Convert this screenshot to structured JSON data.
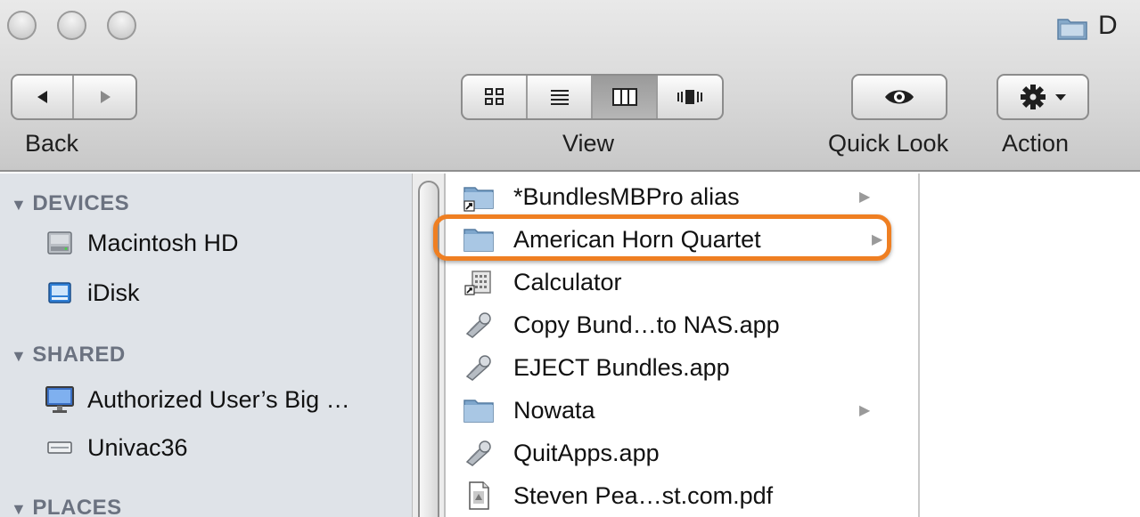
{
  "window": {
    "title": "D"
  },
  "toolbar": {
    "back_label": "Back",
    "view_label": "View",
    "quick_look_label": "Quick Look",
    "action_label": "Action",
    "view_modes": [
      "icon-view-icon",
      "list-view-icon",
      "column-view-icon",
      "cover-flow-icon"
    ],
    "active_view": "column-view-icon"
  },
  "sidebar": {
    "devices": {
      "heading": "DEVICES",
      "items": [
        {
          "label": "Macintosh HD",
          "icon": "hard-drive-icon"
        },
        {
          "label": "iDisk",
          "icon": "idisk-icon"
        }
      ]
    },
    "shared": {
      "heading": "SHARED",
      "items": [
        {
          "label": "Authorized User’s Big …",
          "icon": "computer-icon"
        },
        {
          "label": "Univac36",
          "icon": "network-drive-icon"
        }
      ]
    },
    "places": {
      "heading": "PLACES"
    }
  },
  "column": {
    "items": [
      {
        "label": "*BundlesMBPro alias",
        "icon": "folder-alias-icon",
        "has_children": true
      },
      {
        "label": "American Horn Quartet",
        "icon": "folder-icon",
        "has_children": true,
        "highlighted": true
      },
      {
        "label": "Calculator",
        "icon": "calculator-alias-icon",
        "has_children": false
      },
      {
        "label": "Copy Bund…to NAS.app",
        "icon": "applescript-app-icon",
        "has_children": false
      },
      {
        "label": "EJECT Bundles.app",
        "icon": "applescript-app-icon",
        "has_children": false
      },
      {
        "label": "Nowata",
        "icon": "folder-icon",
        "has_children": true
      },
      {
        "label": "QuitApps.app",
        "icon": "applescript-app-icon",
        "has_children": false
      },
      {
        "label": "Steven Pea…st.com.pdf",
        "icon": "pdf-document-icon",
        "has_children": false
      }
    ]
  },
  "colors": {
    "highlight": "#ef7f22",
    "sidebar_bg": "#dfe3e8",
    "sidebar_heading": "#6b7280"
  }
}
